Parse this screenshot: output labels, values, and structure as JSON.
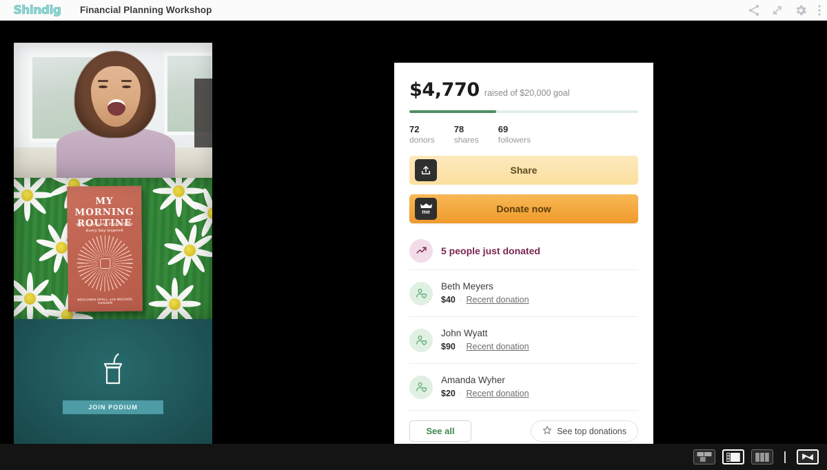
{
  "header": {
    "logo_text": "Shindig",
    "session_title": "Financial Planning Workshop",
    "icons": [
      {
        "name": "share-icon",
        "label": "Share"
      },
      {
        "name": "expand-icon",
        "label": "Expand"
      },
      {
        "name": "gear-icon",
        "label": "Settings"
      },
      {
        "name": "more-vertical-icon",
        "label": "More options"
      }
    ]
  },
  "stage": {
    "participant": {
      "video_alt": "Laughing woman on webcam in a bright room",
      "book": {
        "title_line1": "MY MORNING",
        "title_line2": "ROUTINE",
        "subtitle_line1": "How Successful People Start",
        "subtitle_line2": "Every Day Inspired",
        "authors": "BENJAMIN SPALL and MICHAEL XANDER",
        "background_alt": "Green daisy pattern backdrop"
      },
      "podium": {
        "icon": "podium-icon",
        "button_label": "JOIN PODIUM"
      }
    }
  },
  "donation_panel": {
    "raised_amount": "$4,770",
    "goal_text": "raised of $20,000 goal",
    "progress_percent": 38,
    "progress_color": "#4e8f62",
    "stats": [
      {
        "value": "72",
        "label": "donors"
      },
      {
        "value": "78",
        "label": "shares"
      },
      {
        "value": "69",
        "label": "followers"
      }
    ],
    "share_button": {
      "label": "Share",
      "icon": "upload-icon",
      "color": "#fbdf9f"
    },
    "donate_button": {
      "label": "Donate now",
      "icon": "gofundme-me-icon",
      "color": "#ef9a2c"
    },
    "activity": {
      "icon": "trending-up-icon",
      "text": "5 people just donated",
      "color": "#79264f"
    },
    "donors": [
      {
        "name": "Beth Meyers",
        "amount": "$40",
        "separator": "·",
        "link": "Recent donation",
        "avatar_icon": "person-heart-icon"
      },
      {
        "name": "John Wyatt",
        "amount": "$90",
        "separator": "·",
        "link": "Recent donation",
        "avatar_icon": "person-heart-icon"
      },
      {
        "name": "Amanda Wyher",
        "amount": "$20",
        "separator": "·",
        "link": "Recent donation",
        "avatar_icon": "person-heart-icon"
      }
    ],
    "see_all_label": "See all",
    "see_top_label": "See top donations",
    "see_top_icon": "star-icon"
  },
  "bottom_bar": {
    "layout_buttons": [
      {
        "name": "layout-grid-button",
        "active": false
      },
      {
        "name": "layout-sidebar-button",
        "active": true
      },
      {
        "name": "layout-columns-button",
        "active": false
      }
    ],
    "fullscreen_button": {
      "name": "fullscreen-button"
    }
  }
}
